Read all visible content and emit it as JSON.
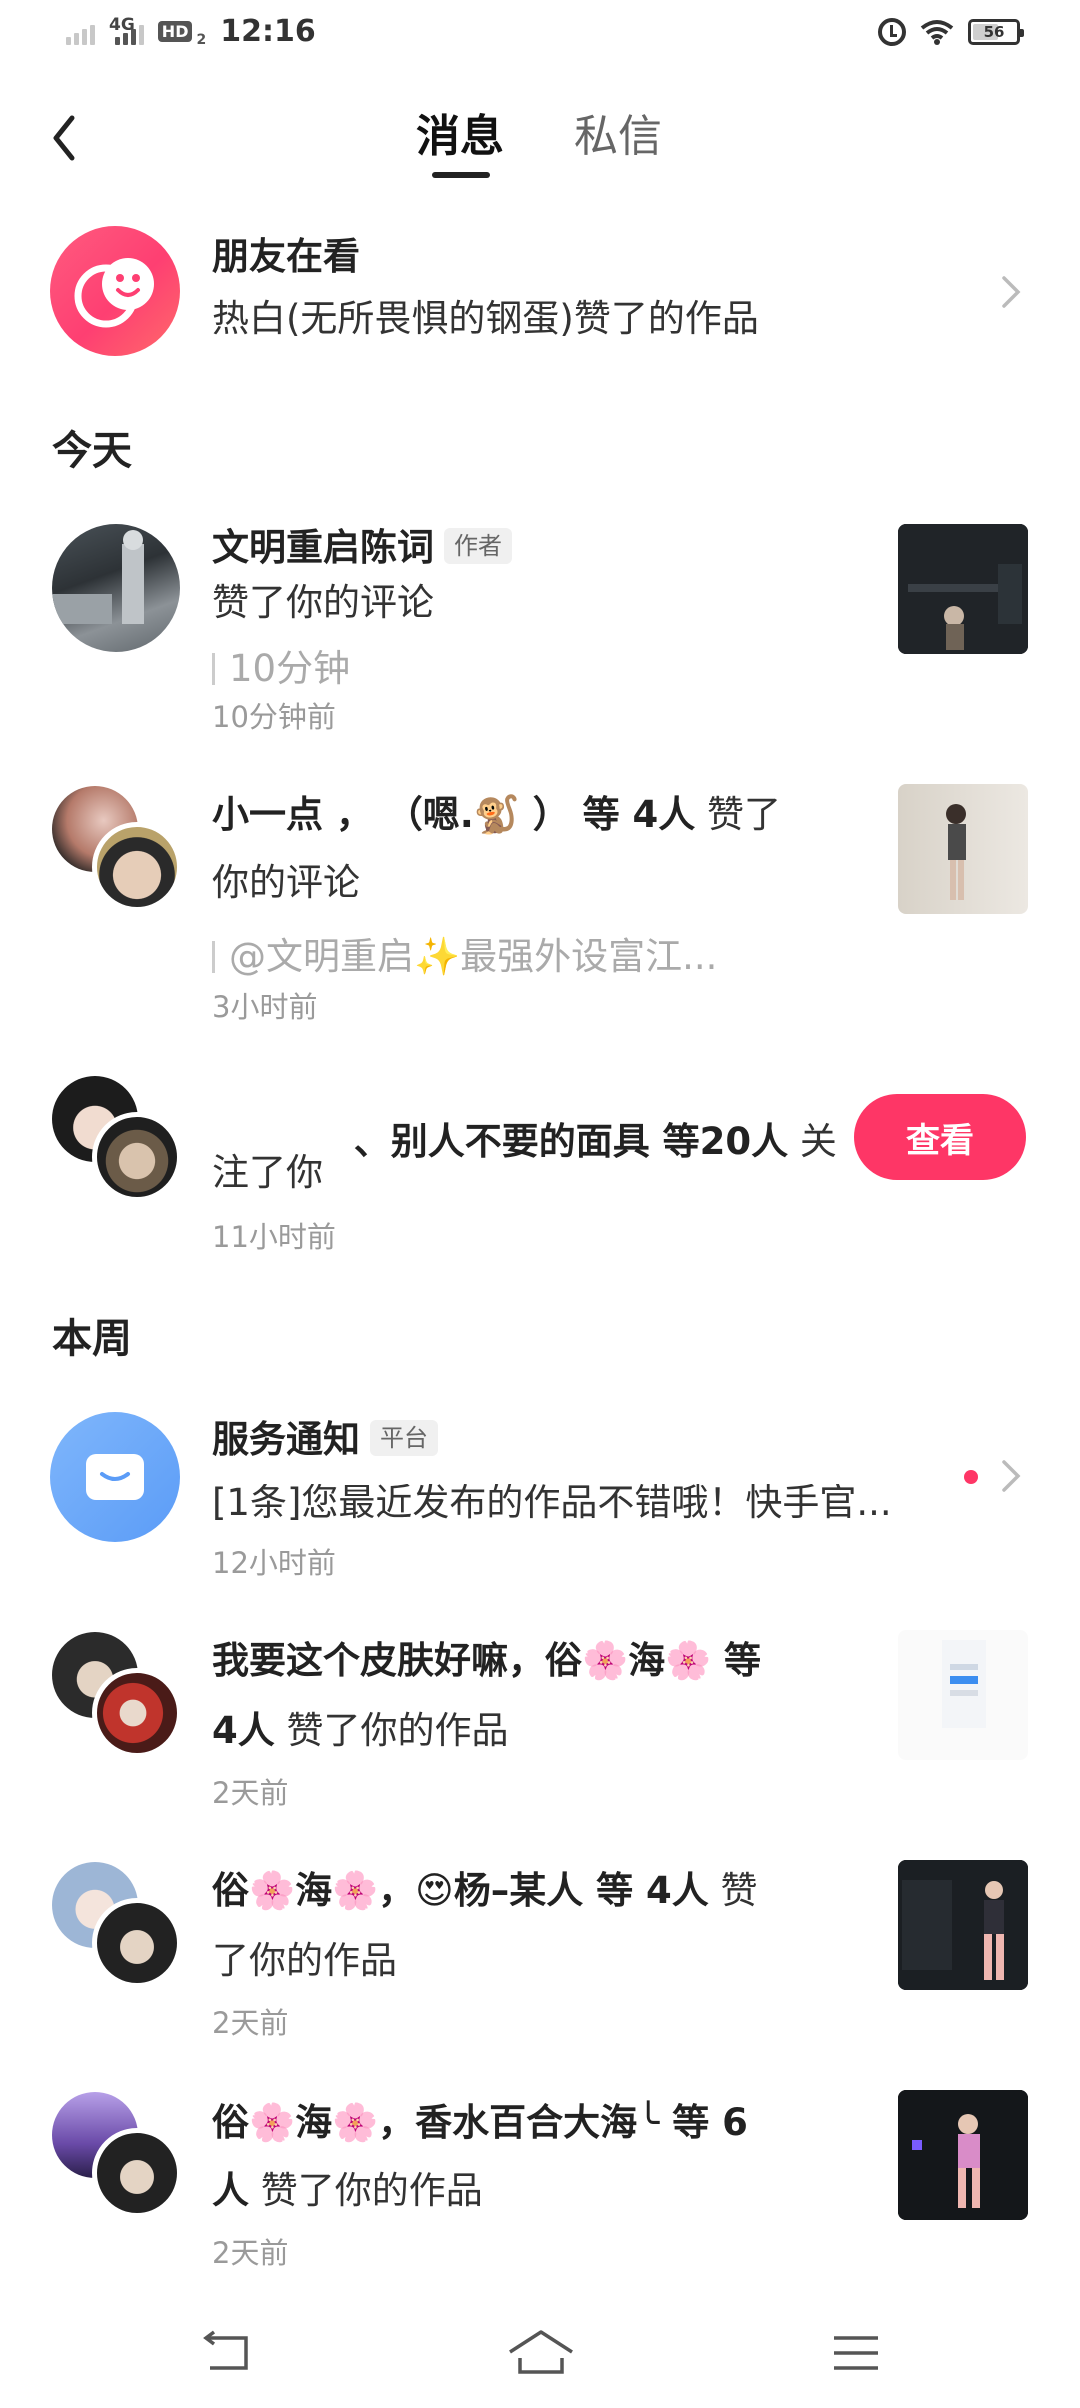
{
  "status_bar": {
    "network_label": "4G",
    "hd_label": "HD",
    "hd_sub": "2",
    "time": "12:16",
    "battery": "56",
    "battery_level": 0.56
  },
  "header": {
    "tab_active": "消息",
    "tab_inactive": "私信"
  },
  "friends_watching": {
    "title": "朋友在看",
    "subtitle": "热白(无所畏惧的钢蛋)赞了的作品",
    "icon_color": "#fe3f72"
  },
  "sections": {
    "today": "今天",
    "this_week": "本周"
  },
  "notifications": [
    {
      "name": "文明重启陈词",
      "tag": "作者",
      "action": "赞了你的评论",
      "quote": "10分钟",
      "time": "10分钟前"
    },
    {
      "names": "小一点 ， （嗯.🐒 ） 等 4人",
      "action_inline": " 赞了",
      "action_line2": "你的评论",
      "quote": "@文明重启✨最强外设富江...",
      "time": "3小时前"
    },
    {
      "names": "       、别人不要的面具 等20人",
      "action_inline": " 关",
      "action_line2": "注了你",
      "time": "11小时前",
      "button": "查看"
    },
    {
      "name": "服务通知",
      "tag": "平台",
      "action": "[1条]您最近发布的作品不错哦！快手官...",
      "time": "12小时前",
      "icon_color": "#5b9cf7"
    },
    {
      "names": "我要这个皮肤好嘛，俗🌸海🌸 等",
      "line2_bold": "4人",
      "line2_action": " 赞了你的作品",
      "time": "2天前"
    },
    {
      "names": "俗🌸海🌸，😍杨–某人 等 4人",
      "action_inline": " 赞",
      "action_line2": "了你的作品",
      "time": "2天前"
    },
    {
      "names": "俗🌸海🌸，香水百合大海╰ 等 6",
      "line2_bold": "人",
      "line2_action": " 赞了你的作品",
      "time": "2天前"
    }
  ],
  "nav": {
    "back": "back-icon",
    "home": "home-icon",
    "menu": "menu-icon"
  },
  "colors": {
    "accent": "#fe3666",
    "text": "#222222",
    "meta": "#9a9a9a"
  }
}
